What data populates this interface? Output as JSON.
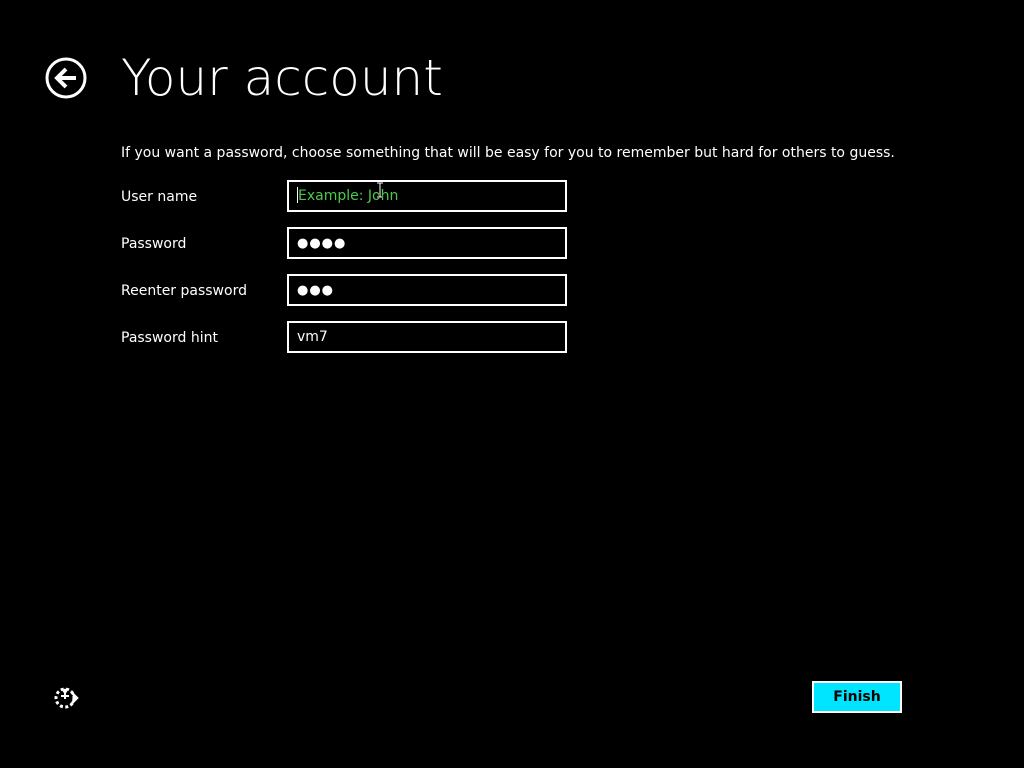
{
  "header": {
    "title": "Your account",
    "back_icon": "back-arrow-circle-icon"
  },
  "instructions": "If you want a password, choose something that will be easy for you to remember but hard for others to guess.",
  "form": {
    "username": {
      "label": "User name",
      "value": "",
      "placeholder": "Example: John"
    },
    "password": {
      "label": "Password",
      "masked_value": "●●●●"
    },
    "reenter_password": {
      "label": "Reenter password",
      "masked_value": "●●●"
    },
    "password_hint": {
      "label": "Password hint",
      "value": "vm7"
    }
  },
  "footer": {
    "ease_of_access_icon": "ease-of-access-icon",
    "finish_label": "Finish"
  },
  "colors": {
    "background": "#000000",
    "text": "#ffffff",
    "placeholder": "#4ec84e",
    "accent_button": "#00e5ff"
  }
}
